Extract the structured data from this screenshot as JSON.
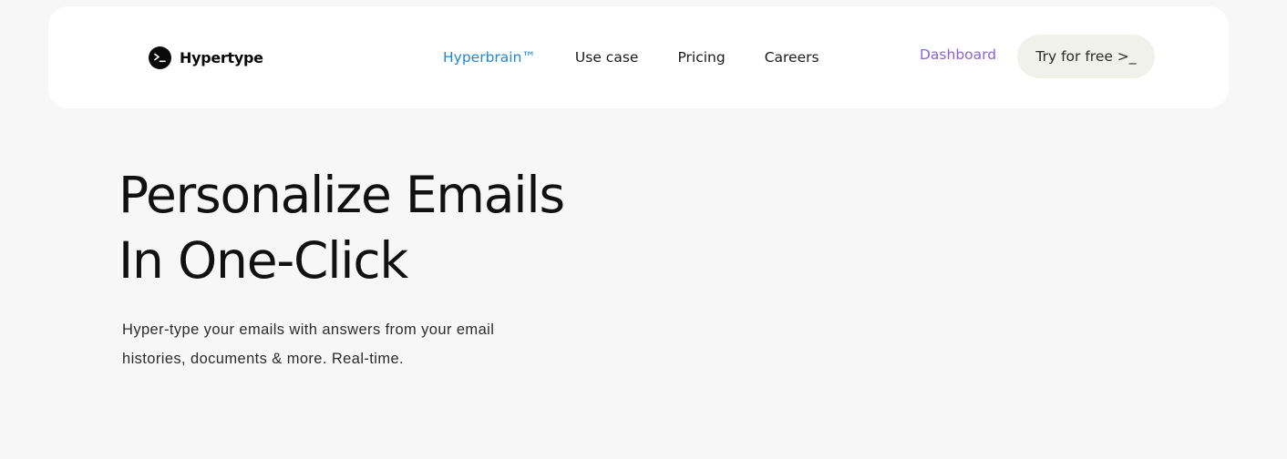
{
  "nav": {
    "logo_text": "Hypertype",
    "logo_icon": "terminal-prompt-icon",
    "links": [
      {
        "label": "Hyperbrain™",
        "active": true
      },
      {
        "label": "Use case",
        "active": false
      },
      {
        "label": "Pricing",
        "active": false
      },
      {
        "label": "Careers",
        "active": false
      }
    ],
    "dashboard_label": "Dashboard",
    "cta_label": "Try for free >_"
  },
  "hero": {
    "title_line1": "Personalize Emails",
    "title_line2": "In One-Click",
    "subtitle": "Hyper-type your emails with answers from your email histories, documents & more. Real-time."
  },
  "colors": {
    "page_background": "#f7f7f7",
    "active_link": "#1f87d6",
    "dashboard_link": "#8a64d6",
    "cta_background": "#f1f1ec"
  }
}
